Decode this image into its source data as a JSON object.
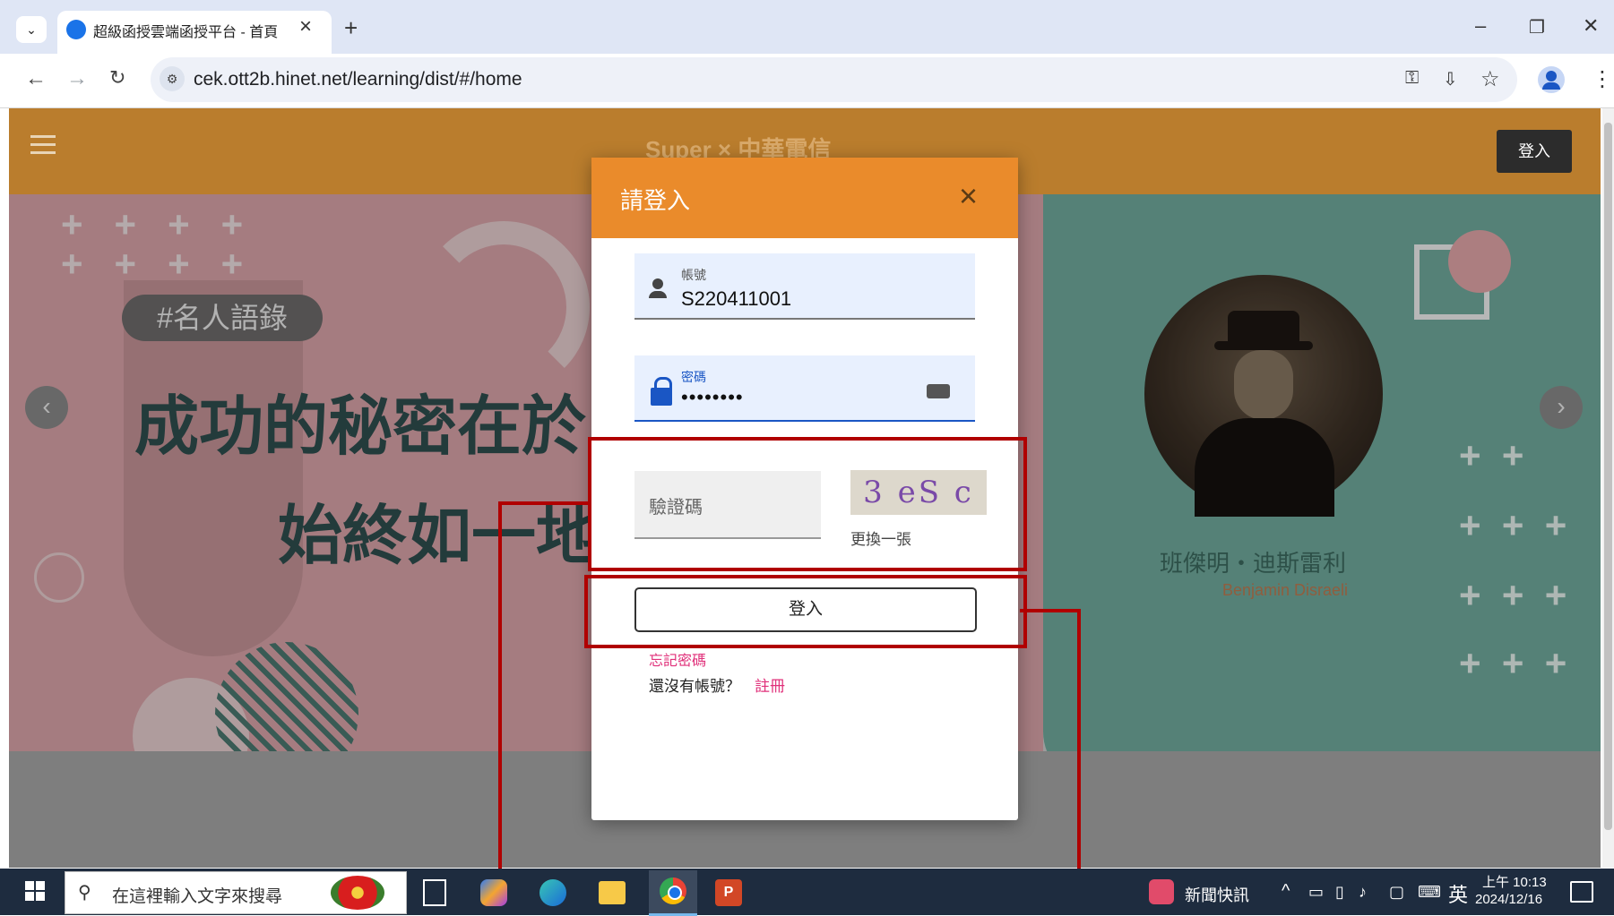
{
  "browser": {
    "tab_title": "超級函授雲端函授平台 - 首頁",
    "tab_close": "×",
    "new_tab": "+",
    "url": "cek.ott2b.hinet.net/learning/dist/#/home",
    "window_minimize": "–",
    "window_restore": "❐",
    "window_close": "✕"
  },
  "site": {
    "header_logo": "Super × 中華電信",
    "login_button": "登入",
    "hero_tag": "#名人語錄",
    "hero_line1": "成功的秘密在於",
    "hero_line2": "始終如一地",
    "person_name": "班傑明・迪斯雷利",
    "person_name_en": "Benjamin Disraeli"
  },
  "login_modal": {
    "title": "請登入",
    "close": "×",
    "username": {
      "label": "帳號",
      "value": "S220411001"
    },
    "password": {
      "label": "密碼",
      "value": "••••••••"
    },
    "captcha": {
      "placeholder": "驗證碼",
      "image_text": "3 eS c",
      "refresh_label": "更換一張"
    },
    "submit_label": "登入",
    "forgot_password": "忘記密碼",
    "no_account": "還沒有帳號？",
    "register": "註冊"
  },
  "taskbar": {
    "search_placeholder": "在這裡輸入文字來搜尋",
    "news_label": "新聞快訊",
    "ime": "英",
    "time": "上午 10:13",
    "date": "2024/12/16"
  },
  "colors": {
    "header_bar": "#ba7d2d",
    "modal_header": "#ea8b2b",
    "annotation_red": "#b00000",
    "link_pink": "#e0307a"
  }
}
